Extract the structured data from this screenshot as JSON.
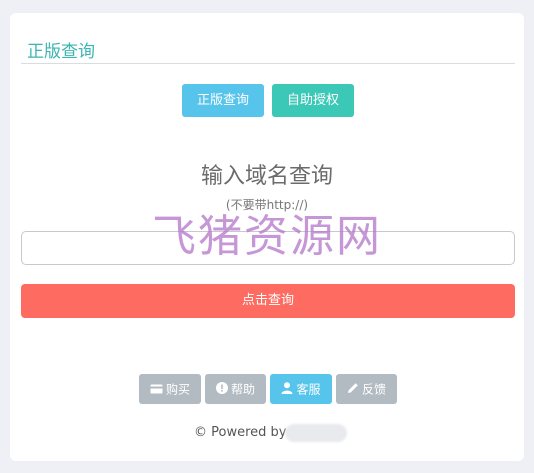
{
  "card": {
    "title": "正版查询"
  },
  "tabs": {
    "genuine_label": "正版查询",
    "self_auth_label": "自助授权"
  },
  "main": {
    "heading": "输入域名查询",
    "hint": "(不要带http://)",
    "input_value": "",
    "input_placeholder": "",
    "query_button": "点击查询"
  },
  "watermark": {
    "text": "飞猪资源网"
  },
  "footer": {
    "buy_label": "购买",
    "help_label": "帮助",
    "service_label": "客服",
    "feedback_label": "反馈",
    "powered_by": "© Powered by"
  },
  "icons": {
    "buy": "credit-card-icon",
    "help": "exclamation-circle-icon",
    "service": "user-icon",
    "feedback": "pencil-icon"
  },
  "colors": {
    "accent_teal": "#3bb5b0",
    "tab_blue": "#57c4ec",
    "tab_green": "#3cc8b7",
    "query_red": "#fd6b61",
    "footer_gray": "#b3bbc2"
  }
}
